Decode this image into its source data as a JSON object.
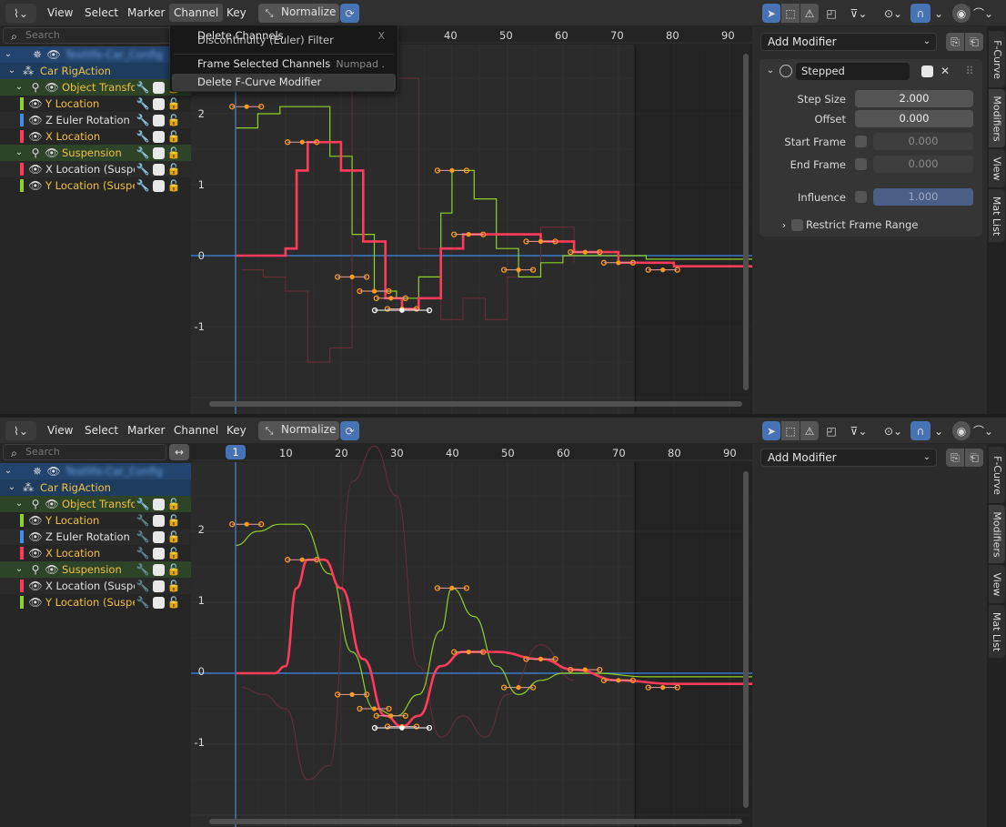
{
  "header": {
    "menus": [
      "View",
      "Select",
      "Marker",
      "Channel",
      "Key"
    ],
    "normalize": "Normalize",
    "add_modifier": "Add Modifier"
  },
  "search": {
    "placeholder": "Search"
  },
  "channels": {
    "object": "Testlife-Car_Config",
    "action": "Car RigAction",
    "group1": "Object Transfo",
    "y_loc": "Y Location",
    "z_rot": "Z Euler Rotation",
    "x_loc": "X Location",
    "group2": "Suspension",
    "x_susp": "X Location (Suspe",
    "y_susp": "Y Location (Suspe"
  },
  "channel_menu": {
    "items": [
      {
        "label": "Delete Channels",
        "shortcut": "X"
      },
      {
        "label": "Discontinuity (Euler) Filter",
        "shortcut": ""
      },
      {
        "label": "Frame Selected Channels",
        "shortcut": "Numpad ."
      },
      {
        "label": "Delete F-Curve Modifier",
        "shortcut": ""
      }
    ]
  },
  "timeline": {
    "frames_top": [
      "40",
      "50",
      "60",
      "70",
      "80",
      "90"
    ],
    "frames_bottom": [
      "10",
      "20",
      "30",
      "40",
      "50",
      "60",
      "70",
      "80",
      "90"
    ],
    "current_frame": "1",
    "values": [
      "2",
      "1",
      "0",
      "-1"
    ]
  },
  "modifier": {
    "name": "Stepped",
    "step_size_label": "Step Size",
    "step_size": "2.000",
    "offset_label": "Offset",
    "offset": "0.000",
    "start_frame_label": "Start Frame",
    "start_frame": "0.000",
    "end_frame_label": "End Frame",
    "end_frame": "0.000",
    "influence_label": "Influence",
    "influence": "1.000",
    "restrict_label": "Restrict Frame Range"
  },
  "side_tabs": [
    "F-Curve",
    "Modifiers",
    "View",
    "Mat List"
  ],
  "colors": {
    "red": "#ff3b5c",
    "green": "#8fd128",
    "blue": "#3d8df0",
    "accent": "#4772b3",
    "key": "#ff9a1a"
  }
}
